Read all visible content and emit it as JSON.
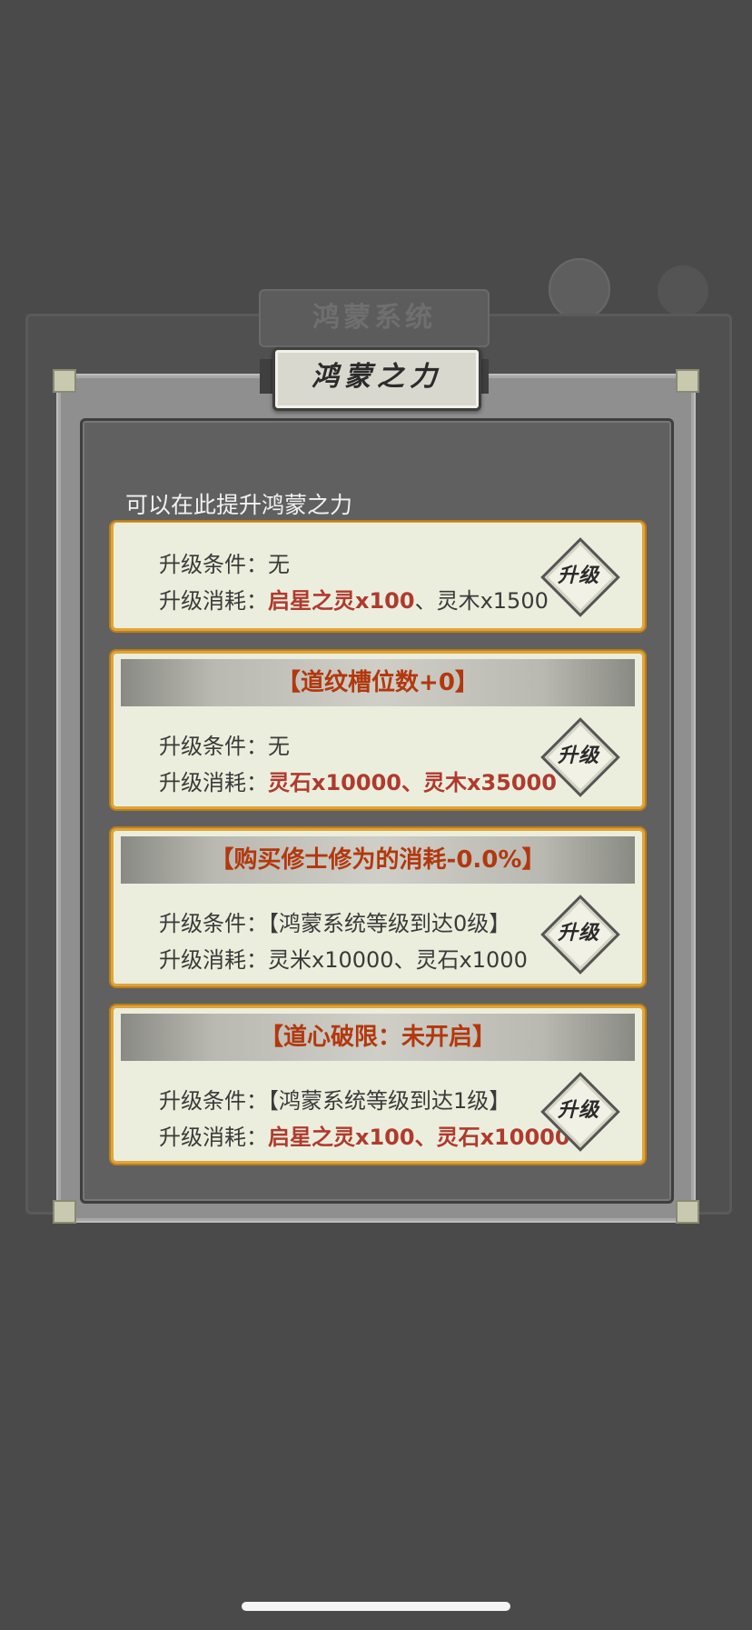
{
  "background": {
    "title": "鸿蒙系统"
  },
  "dialog": {
    "title": "鸿蒙之力",
    "hint": "可以在此提升鸿蒙之力",
    "upgrade_label": "升级",
    "cards": [
      {
        "header": "",
        "cond_label": "升级条件：",
        "cond_value": "无",
        "cost_label": "升级消耗：",
        "cost_part1": "启星之灵x100",
        "cost_sep": "、",
        "cost_part2": "灵木x1500"
      },
      {
        "header": "【道纹槽位数+0】",
        "cond_label": "升级条件：",
        "cond_value": "无",
        "cost_label": "升级消耗：",
        "cost_part1": "灵石x10000",
        "cost_sep": "、",
        "cost_part2": "灵木x35000"
      },
      {
        "header": "【购买修士修为的消耗-0.0%】",
        "cond_label": "升级条件：",
        "cond_value": "【鸿蒙系统等级到达0级】",
        "cost_label": "升级消耗：",
        "cost_part1": "灵米x10000",
        "cost_sep": "、",
        "cost_part2": "灵石x1000"
      },
      {
        "header": "【道心破限：未开启】",
        "cond_label": "升级条件：",
        "cond_value": "【鸿蒙系统等级到达1级】",
        "cost_label": "升级消耗：",
        "cost_part1": "启星之灵x100",
        "cost_sep": "、",
        "cost_part2": "灵石x10000"
      }
    ]
  },
  "colors": {
    "accent": "#e0a438",
    "header_text": "#b2380e",
    "cost_red": "#b03a2e"
  }
}
